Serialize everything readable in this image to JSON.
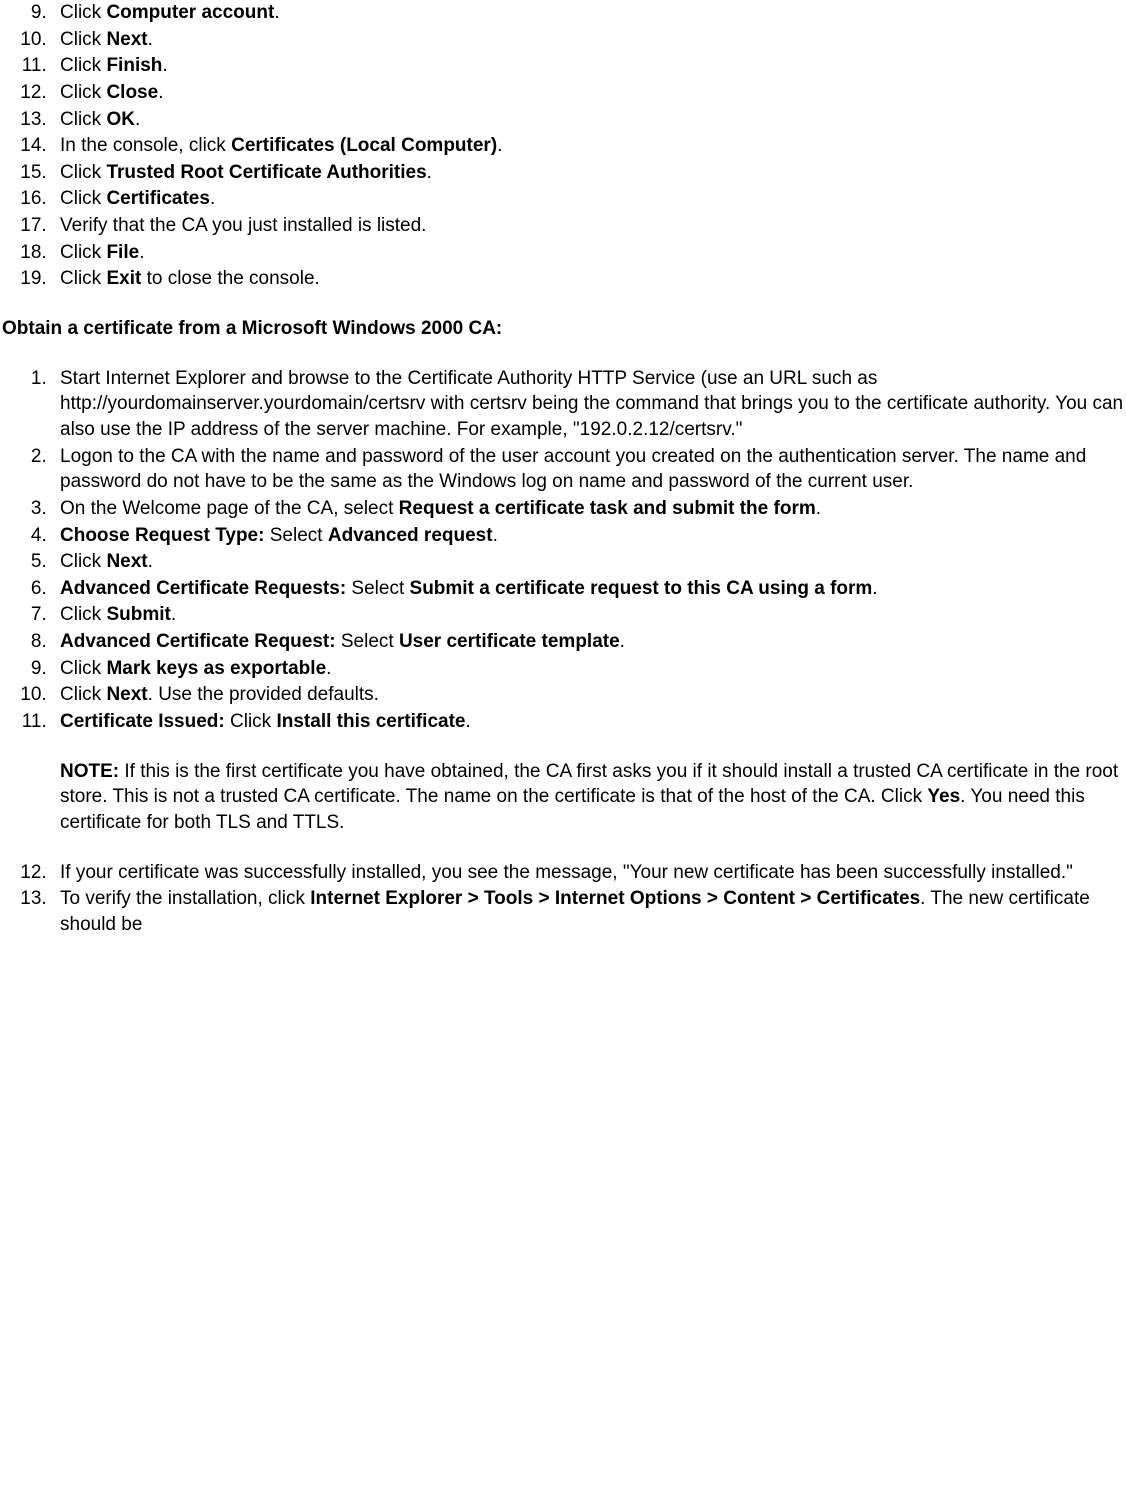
{
  "list1": {
    "start": 9,
    "items": [
      [
        {
          "t": "Click "
        },
        {
          "t": "Computer account",
          "b": true
        },
        {
          "t": "."
        }
      ],
      [
        {
          "t": "Click "
        },
        {
          "t": "Next",
          "b": true
        },
        {
          "t": "."
        }
      ],
      [
        {
          "t": "Click "
        },
        {
          "t": "Finish",
          "b": true
        },
        {
          "t": "."
        }
      ],
      [
        {
          "t": "Click "
        },
        {
          "t": "Close",
          "b": true
        },
        {
          "t": "."
        }
      ],
      [
        {
          "t": "Click "
        },
        {
          "t": "OK",
          "b": true
        },
        {
          "t": "."
        }
      ],
      [
        {
          "t": "In the console, click "
        },
        {
          "t": "Certificates (Local Computer)",
          "b": true
        },
        {
          "t": "."
        }
      ],
      [
        {
          "t": "Click "
        },
        {
          "t": "Trusted Root Certificate Authorities",
          "b": true
        },
        {
          "t": "."
        }
      ],
      [
        {
          "t": "Click "
        },
        {
          "t": "Certificates",
          "b": true
        },
        {
          "t": "."
        }
      ],
      [
        {
          "t": "Verify that the CA you just installed is listed."
        }
      ],
      [
        {
          "t": "Click "
        },
        {
          "t": "File",
          "b": true
        },
        {
          "t": "."
        }
      ],
      [
        {
          "t": "Click "
        },
        {
          "t": "Exit",
          "b": true
        },
        {
          "t": " to close the console."
        }
      ]
    ]
  },
  "heading": "Obtain a certificate from a Microsoft Windows 2000 CA:",
  "list2": {
    "start": 1,
    "items": [
      {
        "runs": [
          {
            "t": "Start Internet Explorer and browse to the Certificate Authority HTTP Service (use an URL such as http://yourdomainserver.yourdomain/certsrv with certsrv being the command that brings you to the certificate authority. You can also use the IP address of the server machine. For example, \"192.0.2.12/certsrv.\""
          }
        ]
      },
      {
        "runs": [
          {
            "t": "Logon to the CA with the name and password of the user account you created on the authentication server. The name and password do not have to be the same as the Windows log on name and password of the current user."
          }
        ]
      },
      {
        "runs": [
          {
            "t": "On the Welcome page of the CA, select "
          },
          {
            "t": "Request a certificate task and submit the form",
            "b": true
          },
          {
            "t": "."
          }
        ]
      },
      {
        "runs": [
          {
            "t": "Choose Request Type:",
            "b": true
          },
          {
            "t": " Select "
          },
          {
            "t": "Advanced request",
            "b": true
          },
          {
            "t": "."
          }
        ]
      },
      {
        "runs": [
          {
            "t": "Click "
          },
          {
            "t": "Next",
            "b": true
          },
          {
            "t": "."
          }
        ]
      },
      {
        "runs": [
          {
            "t": "Advanced Certificate Requests:",
            "b": true
          },
          {
            "t": " Select "
          },
          {
            "t": "Submit a certificate request to this CA using a form",
            "b": true
          },
          {
            "t": "."
          }
        ]
      },
      {
        "runs": [
          {
            "t": "Click "
          },
          {
            "t": "Submit",
            "b": true
          },
          {
            "t": "."
          }
        ]
      },
      {
        "runs": [
          {
            "t": "Advanced Certificate Request:",
            "b": true
          },
          {
            "t": " Select "
          },
          {
            "t": "User certificate template",
            "b": true
          },
          {
            "t": "."
          }
        ]
      },
      {
        "runs": [
          {
            "t": "Click "
          },
          {
            "t": "Mark keys as exportable",
            "b": true
          },
          {
            "t": "."
          }
        ]
      },
      {
        "runs": [
          {
            "t": "Click "
          },
          {
            "t": "Next",
            "b": true
          },
          {
            "t": ". Use the provided defaults."
          }
        ]
      },
      {
        "runs": [
          {
            "t": "Certificate Issued:",
            "b": true
          },
          {
            "t": " Click "
          },
          {
            "t": "Install this certificate",
            "b": true
          },
          {
            "t": "."
          }
        ],
        "note": [
          {
            "t": "NOTE:",
            "b": true
          },
          {
            "t": " If this is the first certificate you have obtained, the CA first asks you if it should install a trusted CA certificate in the root store. This is not a trusted CA certificate. The name on the certificate is that of the host of the CA. Click "
          },
          {
            "t": "Yes",
            "b": true
          },
          {
            "t": ". You need this certificate for both TLS and TTLS."
          }
        ]
      },
      {
        "runs": [
          {
            "t": "If your certificate was successfully installed, you see the message, \"Your new certificate has been successfully installed.\""
          }
        ]
      },
      {
        "runs": [
          {
            "t": "To verify the installation, click "
          },
          {
            "t": "Internet Explorer > Tools > Internet Options > Content > Certificates",
            "b": true
          },
          {
            "t": ". The new certificate should be"
          }
        ]
      }
    ]
  }
}
